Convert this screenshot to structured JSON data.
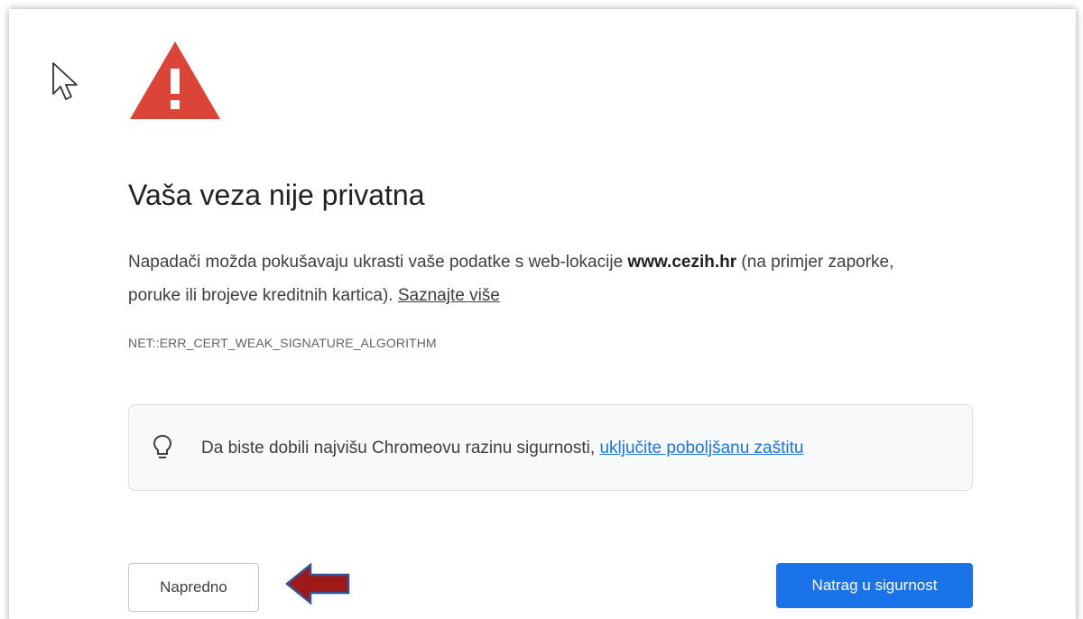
{
  "interstitial": {
    "title": "Vaša veza nije privatna",
    "description_before": "Napadači možda pokušavaju ukrasti vaše podatke s web-lokacije ",
    "domain": "www.cezih.hr",
    "description_after": " (na primjer zaporke, poruke ili brojeve kreditnih kartica). ",
    "learn_more_label": "Saznajte više",
    "error_code": "NET::ERR_CERT_WEAK_SIGNATURE_ALGORITHM",
    "tip": {
      "icon": "lightbulb-icon",
      "text": "Da biste dobili najvišu Chromeovu razinu sigurnosti, ",
      "link_label": "uključite poboljšanu zaštitu"
    },
    "buttons": {
      "advanced_label": "Napredno",
      "back_label": "Natrag u sigurnost"
    }
  },
  "icons": {
    "warning": "warning-triangle-icon",
    "cursor": "mouse-cursor-icon",
    "annotation": "red-arrow-annotation"
  },
  "colors": {
    "warning_red": "#db4437",
    "primary_blue": "#1a73e8",
    "link_blue": "#1a73e8",
    "annotation_red": "#a01818",
    "annotation_outline": "#2f5597",
    "tip_background": "#f8f9fa"
  }
}
